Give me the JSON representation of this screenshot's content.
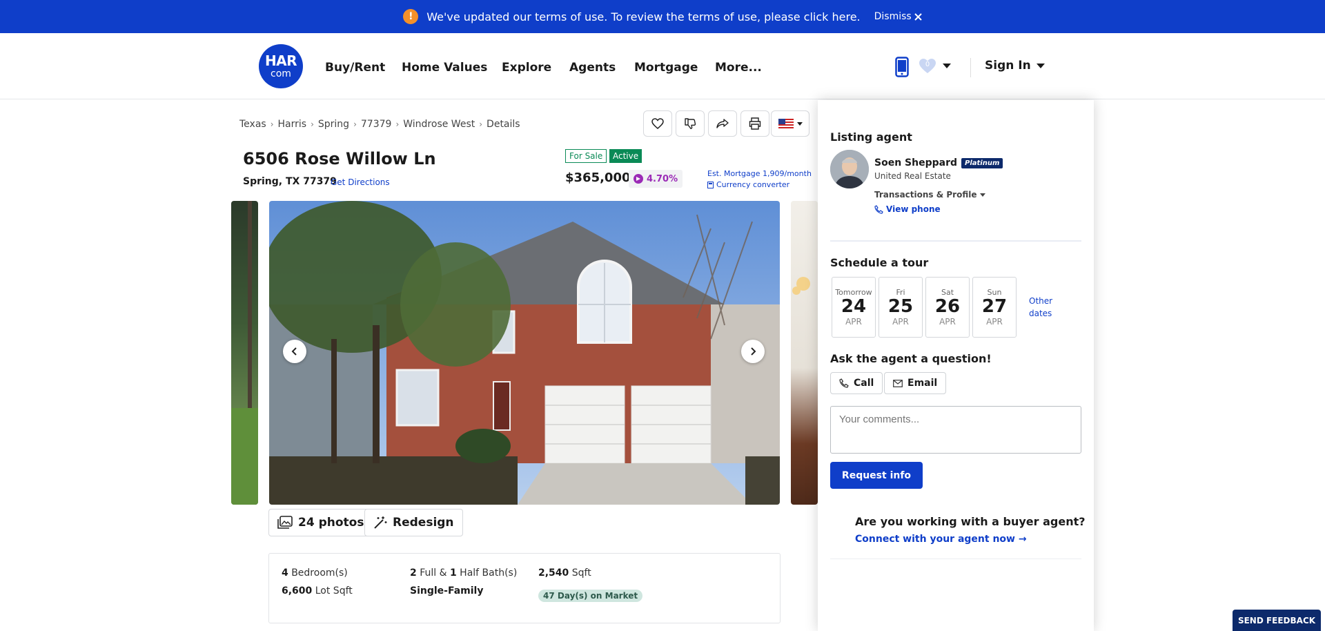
{
  "banner": {
    "message": "We've updated our terms of use. To review the terms of use, please click here.",
    "warn_glyph": "!",
    "dismiss_label": "Dismiss",
    "color": "#0f3ec9"
  },
  "header": {
    "logo_top": "HAR",
    "logo_bottom": "com",
    "nav": [
      "Buy/Rent",
      "Home Values",
      "Explore",
      "Agents",
      "Mortgage",
      "More..."
    ],
    "favorites_count": "0",
    "signin_label": "Sign In"
  },
  "breadcrumb": [
    "Texas",
    "Harris",
    "Spring",
    "77379",
    "Windrose West",
    "Details"
  ],
  "listing": {
    "address": "6506 Rose Willow Ln",
    "city_line": "Spring, TX 77379",
    "directions_label": "Get Directions",
    "tag_sale": "For Sale",
    "tag_active": "Active",
    "price": "$365,000",
    "rate": "4.70%",
    "est_mortgage": "Est. Mortgage 1,909/month",
    "currency_converter": "Currency converter"
  },
  "gallery": {
    "photos_label": "24 photos",
    "redesign_label": "Redesign"
  },
  "facts": {
    "bed_num": "4",
    "bed_label": "Bedroom(s)",
    "full_bath": "2",
    "full_label": "Full &",
    "half_bath": "1",
    "half_label": "Half Bath(s)",
    "sqft_num": "2,540",
    "sqft_label": "Sqft",
    "lot_num": "6,600",
    "lot_label": "Lot Sqft",
    "type": "Single-Family",
    "days_on_market": "47 Day(s) on Market"
  },
  "agent_panel": {
    "listing_title": "Listing agent",
    "agent_name": "Soen Sheppard",
    "agent_badge": "Platinum",
    "agent_company": "United Real Estate",
    "transactions_label": "Transactions & Profile",
    "view_phone": "View phone",
    "tour_title": "Schedule a tour",
    "days": [
      {
        "name": "Tomorrow",
        "date": "24",
        "month": "APR"
      },
      {
        "name": "Fri",
        "date": "25",
        "month": "APR"
      },
      {
        "name": "Sat",
        "date": "26",
        "month": "APR"
      },
      {
        "name": "Sun",
        "date": "27",
        "month": "APR"
      }
    ],
    "other_dates_1": "Other",
    "other_dates_2": "dates",
    "question_title": "Ask the agent a question!",
    "call_label": "Call",
    "email_label": "Email",
    "comments_placeholder": "Your comments...",
    "request_label": "Request info",
    "buyer_agent_q": "Are you working with a buyer agent?",
    "connect_label": "Connect with your agent now →"
  },
  "feedback_label": "SEND FEEDBACK"
}
